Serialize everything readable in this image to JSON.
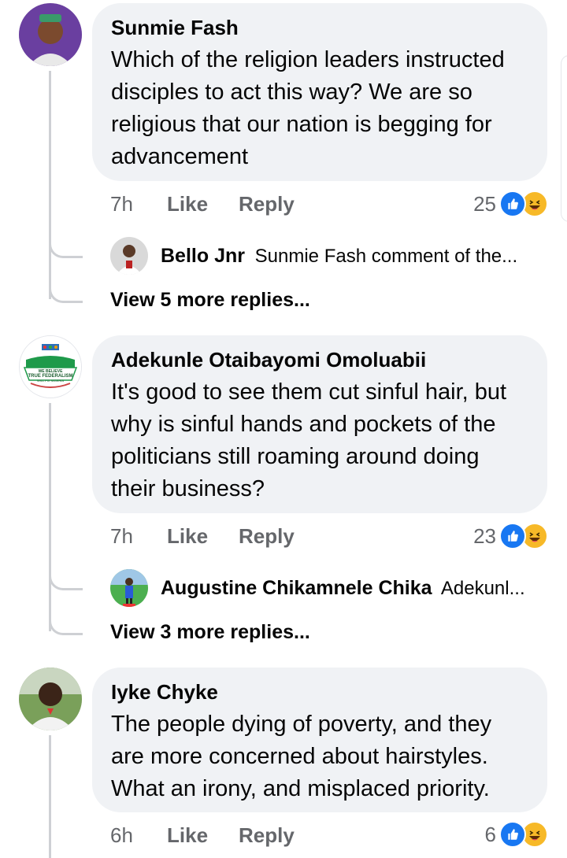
{
  "comments": [
    {
      "author": "Sunmie Fash",
      "text": "Which of the religion leaders instructed disciples to act this way? We are so religious that our nation is begging for advancement",
      "time": "7h",
      "like_label": "Like",
      "reply_label": "Reply",
      "reaction_count": "25",
      "reactions": [
        "like-icon",
        "haha-icon"
      ],
      "reply_preview": {
        "author": "Bello Jnr",
        "snippet": "Sunmie Fash comment of the..."
      },
      "more_replies": "View 5 more replies..."
    },
    {
      "author": "Adekunle Otaibayomi Omoluabii",
      "text": "It's good to see them cut sinful hair, but why is sinful hands and pockets of the politicians still roaming around doing their business?",
      "time": "7h",
      "like_label": "Like",
      "reply_label": "Reply",
      "reaction_count": "23",
      "reactions": [
        "like-icon",
        "haha-icon"
      ],
      "avatar_text": [
        "WE BELIEVE",
        "TRUE FEDERALISM",
        "WILL FIX NIGERIA"
      ],
      "reply_preview": {
        "author": "Augustine Chikamnele Chika",
        "snippet": "Adekunl..."
      },
      "more_replies": "View 3 more replies..."
    },
    {
      "author": "Iyke Chyke",
      "text": "The people dying of poverty, and they are more concerned about hairstyles. What an irony, and misplaced priority.",
      "time": "6h",
      "like_label": "Like",
      "reply_label": "Reply",
      "reaction_count": "6",
      "reactions": [
        "like-icon",
        "haha-icon"
      ]
    }
  ],
  "colors": {
    "bubble": "#f0f2f5",
    "meta_text": "#65676b",
    "like_blue": "#1877f2",
    "haha_yellow": "#f7b928",
    "thread_line": "#ced0d4"
  }
}
